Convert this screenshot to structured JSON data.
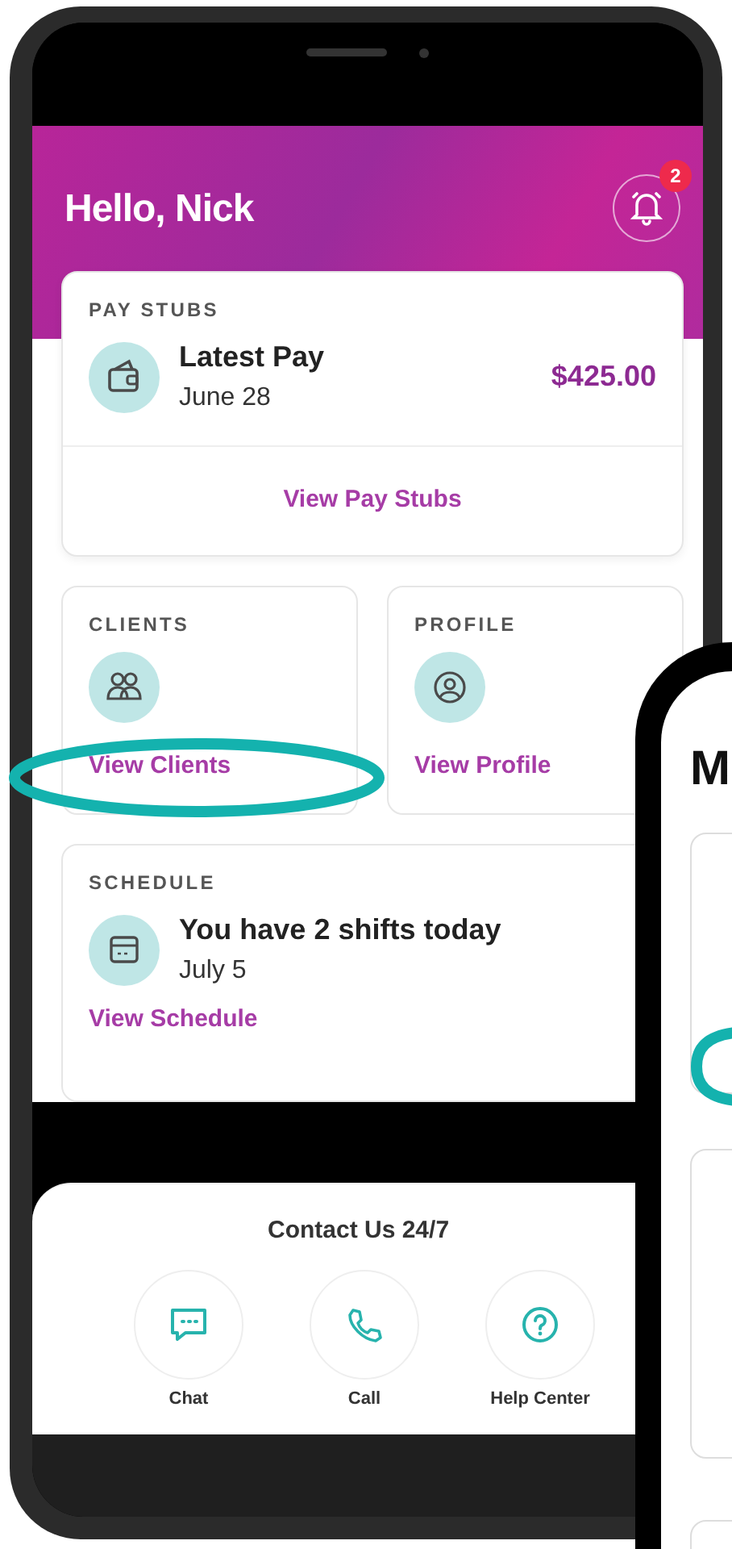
{
  "header": {
    "greeting": "Hello, Nick",
    "notification_count": "2"
  },
  "pay_stubs": {
    "title": "PAY STUBS",
    "label": "Latest Pay",
    "date": "June 28",
    "amount": "$425.00",
    "link": "View Pay Stubs"
  },
  "clients": {
    "title": "CLIENTS",
    "link": "View Clients"
  },
  "profile": {
    "title": "PROFILE",
    "link": "View Profile"
  },
  "schedule": {
    "title": "SCHEDULE",
    "message": "You have 2 shifts today",
    "date": "July 5",
    "link": "View Schedule"
  },
  "contact": {
    "title": "Contact Us 24/7",
    "actions": [
      {
        "kind": "chat",
        "label": "Chat"
      },
      {
        "kind": "call",
        "label": "Call"
      },
      {
        "kind": "help",
        "label": "Help Center"
      }
    ]
  },
  "second_phone": {
    "title": "M"
  }
}
